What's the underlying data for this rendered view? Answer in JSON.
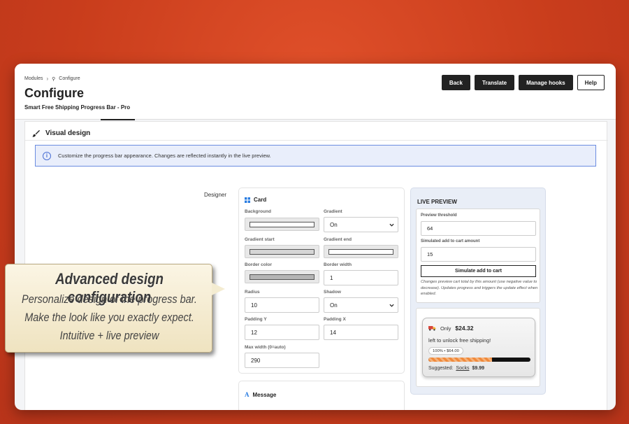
{
  "breadcrumb": {
    "items": [
      "Modules",
      "Configure"
    ]
  },
  "header": {
    "title": "Configure",
    "subtitle": "Smart Free Shipping Progress Bar - Pro",
    "buttons": [
      "Back",
      "Translate",
      "Manage hooks",
      "Help"
    ]
  },
  "panel": {
    "title": "Visual design",
    "info": "Customize the progress bar appearance. Changes are reflected instantly in the live preview.",
    "designer_label": "Designer"
  },
  "card": {
    "title": "Card",
    "background": {
      "label": "Background",
      "color": "#ffffff"
    },
    "gradient": {
      "label": "Gradient",
      "value": "On"
    },
    "gradient_start": {
      "label": "Gradient start",
      "color": "#d6d6d6"
    },
    "gradient_end": {
      "label": "Gradient end",
      "color": "#ffffff"
    },
    "border_color": {
      "label": "Border color",
      "color": "#b5b5b5"
    },
    "border_width": {
      "label": "Border width",
      "value": "1"
    },
    "radius": {
      "label": "Radius",
      "value": "10"
    },
    "shadow": {
      "label": "Shadow",
      "value": "On"
    },
    "padding_y": {
      "label": "Padding Y",
      "value": "12"
    },
    "padding_x": {
      "label": "Padding X",
      "value": "14"
    },
    "max_width": {
      "label": "Max width (0=auto)",
      "value": "290"
    }
  },
  "message_card": {
    "title": "Message"
  },
  "preview": {
    "title": "LIVE PREVIEW",
    "threshold_label": "Preview threshold",
    "threshold_value": "64",
    "simulated_label": "Simulated add to cart amount",
    "simulated_value": "15",
    "simulate_button": "Simulate add to cart",
    "help": "Changes preview cart total by this amount (use negative value to decrease). Updates progress and triggers the update effect when enabled.",
    "bar": {
      "only": "Only",
      "amount": "$24.32",
      "text": "left to unlock free shipping!",
      "badge": "100% • $64.00",
      "progress": 0.62,
      "suggested_label": "Suggested:",
      "suggested_item": "Socks",
      "suggested_price": "$9.99"
    }
  },
  "callout": {
    "title": "Advanced design configuration",
    "lines": [
      "Personalize design of the progress bar.",
      "Make the look like you exactly expect.",
      "Intuitive + live preview"
    ]
  },
  "colors": {
    "brand_bg": "#d2421f",
    "accent": "#222222",
    "info_border": "#6b8ce0",
    "progress_fill": "#f08a3c"
  }
}
